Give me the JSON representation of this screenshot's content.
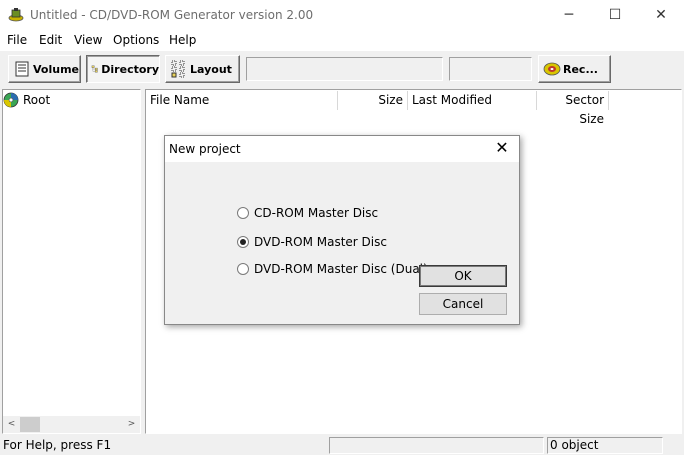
{
  "window": {
    "title": "Untitled - CD/DVD-ROM Generator version 2.00",
    "minimize_glyph": "─",
    "maximize_glyph": "☐",
    "close_glyph": "✕"
  },
  "menu": {
    "items": [
      {
        "label": "File"
      },
      {
        "label": "Edit"
      },
      {
        "label": "View"
      },
      {
        "label": "Options"
      },
      {
        "label": "Help"
      }
    ]
  },
  "toolbar": {
    "volume_label": "Volume",
    "directory_label": "Directory",
    "layout_label": "Layout",
    "record_label": "Rec...",
    "active_tab": "Directory"
  },
  "tree": {
    "root_label": "Root",
    "scroll_left_glyph": "<",
    "scroll_right_glyph": ">"
  },
  "list": {
    "columns": [
      {
        "label": "File Name"
      },
      {
        "label": "Size"
      },
      {
        "label": "Last Modified"
      },
      {
        "label": "Sector Size"
      }
    ],
    "rows": []
  },
  "status": {
    "help_text": "For Help, press F1",
    "object_count": "0 object"
  },
  "dialog": {
    "title": "New project",
    "close_glyph": "✕",
    "options": [
      {
        "label": "CD-ROM Master Disc",
        "checked": false
      },
      {
        "label": "DVD-ROM Master Disc",
        "checked": true
      },
      {
        "label": "DVD-ROM Master Disc (Dual)",
        "checked": false
      }
    ],
    "ok_label": "OK",
    "cancel_label": "Cancel"
  },
  "icons": {
    "app": "cd-dvd-app-icon",
    "volume": "volume-icon",
    "directory": "directory-tree-icon",
    "layout": "layout-icon",
    "record": "record-disc-icon",
    "root": "disc-root-icon"
  },
  "colors": {
    "chrome": "#f0f0f0",
    "window": "#ffffff",
    "title_text": "#6d6d6d",
    "button_border_default": "#3a3a3a"
  }
}
